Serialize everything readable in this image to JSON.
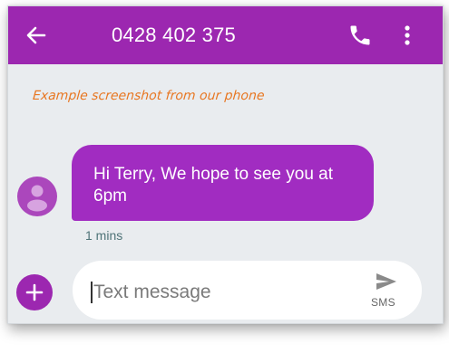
{
  "app_bar": {
    "title": "0428 402 375",
    "background_color": "#9c27b0",
    "back_icon": "arrow-left-icon",
    "call_icon": "phone-icon",
    "menu_icon": "more-vertical-icon"
  },
  "caption": "Example screenshot from our phone",
  "conversation": {
    "messages": [
      {
        "text": "Hi Terry, We hope to see you at 6pm",
        "time": "1 mins",
        "avatar_icon": "person-icon",
        "bubble_color": "#a12cc1"
      }
    ]
  },
  "composer": {
    "attach_icon": "plus-icon",
    "placeholder": "Text message",
    "value": "",
    "send_icon": "send-icon",
    "send_label": "SMS"
  },
  "colors": {
    "accent": "#9c27b0",
    "caption": "#e87722",
    "background": "#e9ecef"
  }
}
